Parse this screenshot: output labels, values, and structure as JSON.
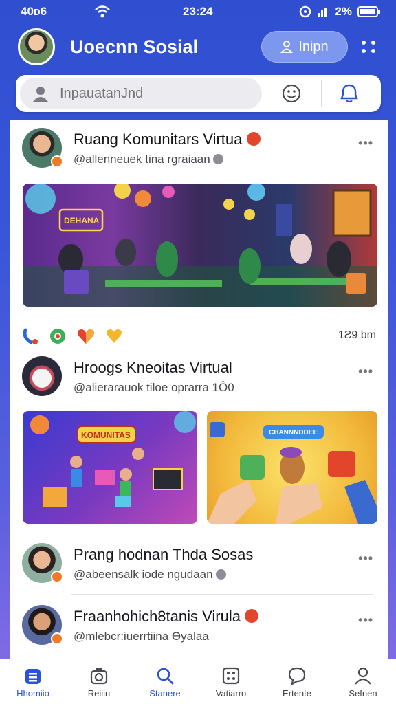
{
  "status": {
    "left": "40ᴅ6",
    "time": "23:24",
    "battery": "2%"
  },
  "header": {
    "title": "Uoecnn Sosial",
    "login_label": "Inipn"
  },
  "search": {
    "placeholder": "InpauatanJnd"
  },
  "posts": [
    {
      "title": "Ruang Komunitars Virtua",
      "subtitle": "@allenneuek tina rgraiaan",
      "time": "1Ƨ9 bm",
      "more": "•••"
    },
    {
      "title": "Hroogs Kneoitas Virtual",
      "subtitle": "@alierarauok tiloe oprarra 1Ô0",
      "more": "•••"
    },
    {
      "title": "Prang hodnan Thda Sosas",
      "subtitle": "@abeensalk iode ngudaan",
      "more": "•••"
    },
    {
      "title": "Fraanhohich8tanis Virula",
      "subtitle": "@mlebcr:iuerrtiina Ɵyalaa",
      "more": "•••"
    }
  ],
  "image_text": {
    "neon_sign": "DEHANA",
    "banner_left": "KOMUNITAS",
    "banner_right": "CHANNNDDEE"
  },
  "nav": [
    {
      "label": "Hhomiio",
      "icon": "home-icon",
      "active": true
    },
    {
      "label": "Reiiin",
      "icon": "camera-icon",
      "active": false
    },
    {
      "label": "Stanere",
      "icon": "search-icon",
      "active": false
    },
    {
      "label": "Vatiarro",
      "icon": "grid-icon",
      "active": false
    },
    {
      "label": "Ertente",
      "icon": "chat-icon",
      "active": false
    },
    {
      "label": "Sefnen",
      "icon": "profile-icon",
      "active": false
    }
  ],
  "colors": {
    "primary": "#2f4fd0",
    "accent": "#2b53d6",
    "badge": "#f07a2a"
  }
}
